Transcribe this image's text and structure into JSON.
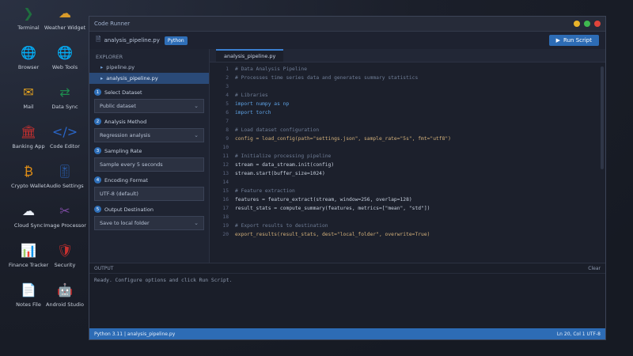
{
  "desktop": {
    "icons": [
      {
        "name": "terminal-icon",
        "glyph": "❯",
        "label": "Terminal",
        "color": "#1f6f3f"
      },
      {
        "name": "weather-icon",
        "glyph": "☁",
        "label": "Weather Widget",
        "color": "#d89a2a"
      },
      {
        "name": "browser-icon",
        "glyph": "🌐",
        "label": "Browser",
        "color": "#2a66c8"
      },
      {
        "name": "web-tools-icon",
        "glyph": "🌐",
        "label": "Web Tools",
        "color": "#2a66c8"
      },
      {
        "name": "mail-icon",
        "glyph": "✉",
        "label": "Mail",
        "color": "#e2a11f"
      },
      {
        "name": "sync-icon",
        "glyph": "⇄",
        "label": "Data Sync",
        "color": "#1e8a4e"
      },
      {
        "name": "bank-icon",
        "glyph": "🏛",
        "label": "Banking App",
        "color": "#c8302f"
      },
      {
        "name": "code-icon",
        "glyph": "</>",
        "label": "Code Editor",
        "color": "#2a66c8"
      },
      {
        "name": "crypto-wallet-icon",
        "glyph": "₿",
        "label": "Crypto Wallet",
        "color": "#e08e16"
      },
      {
        "name": "audio-icon",
        "glyph": "🎚",
        "label": "Audio Settings",
        "color": "#2a5fb0"
      },
      {
        "name": "cloud-icon",
        "glyph": "☁",
        "label": "Cloud Sync",
        "color": "#e9eef6"
      },
      {
        "name": "image-icon",
        "glyph": "✂",
        "label": "Image Processor",
        "color": "#7b4aa0"
      },
      {
        "name": "finance-icon",
        "glyph": "📊",
        "label": "Finance Tracker",
        "color": "#c8302f"
      },
      {
        "name": "shield-icon",
        "glyph": "🛡",
        "label": "Security",
        "color": "#c8302f"
      },
      {
        "name": "document-icon",
        "glyph": "📄",
        "label": "Notes File",
        "color": "#e9eef6"
      },
      {
        "name": "android-icon",
        "glyph": "🤖",
        "label": "Android Studio",
        "color": "#3ddc84"
      }
    ]
  },
  "window": {
    "title": "Code Runner",
    "toolbar": {
      "file": "analysis_pipeline.py",
      "badge": "Python",
      "run_label": "Run Script"
    },
    "sidebar": {
      "header": "EXPLORER",
      "items": [
        {
          "label": "pipeline.py"
        },
        {
          "label": "analysis_pipeline.py"
        }
      ],
      "sections": [
        {
          "n": "1",
          "label": "Select Dataset",
          "value": "Public dataset"
        },
        {
          "n": "2",
          "label": "Analysis Method",
          "value": "Regression analysis"
        },
        {
          "n": "3",
          "label": "Sampling Rate",
          "value": "Sample every 5 seconds"
        },
        {
          "n": "4",
          "label": "Encoding Format",
          "value": "UTF-8 (default)"
        },
        {
          "n": "5",
          "label": "Output Destination",
          "value": "Save to local folder"
        }
      ]
    },
    "editor": {
      "tab": "analysis_pipeline.py",
      "lines": [
        {
          "n": "1",
          "text": "# Data Analysis Pipeline",
          "cls": "cm"
        },
        {
          "n": "2",
          "text": "# Processes time series data and generates summary statistics",
          "cls": "cm"
        },
        {
          "n": "3",
          "text": "",
          "cls": "tx"
        },
        {
          "n": "4",
          "text": "# Libraries",
          "cls": "cm"
        },
        {
          "n": "5",
          "text": "import numpy as np",
          "cls": "kw"
        },
        {
          "n": "6",
          "text": "import torch",
          "cls": "kw"
        },
        {
          "n": "7",
          "text": "",
          "cls": "tx"
        },
        {
          "n": "8",
          "text": "# Load dataset configuration",
          "cls": "cm"
        },
        {
          "n": "9",
          "text": "config = load_config(path=\"settings.json\", sample_rate=\"5s\", fmt=\"utf8\")",
          "cls": "st"
        },
        {
          "n": "10",
          "text": "",
          "cls": "tx"
        },
        {
          "n": "11",
          "text": "# Initialize processing pipeline",
          "cls": "cm"
        },
        {
          "n": "12",
          "text": "stream = data_stream.init(config)",
          "cls": "tx"
        },
        {
          "n": "13",
          "text": "stream.start(buffer_size=1024)",
          "cls": "tx"
        },
        {
          "n": "14",
          "text": "",
          "cls": "tx"
        },
        {
          "n": "15",
          "text": "# Feature extraction",
          "cls": "cm"
        },
        {
          "n": "16",
          "text": "features = feature_extract(stream, window=256, overlap=128)",
          "cls": "tx"
        },
        {
          "n": "17",
          "text": "result_stats = compute_summary(features, metrics=[\"mean\", \"std\"])",
          "cls": "tx"
        },
        {
          "n": "18",
          "text": "",
          "cls": "tx"
        },
        {
          "n": "19",
          "text": "# Export results to destination",
          "cls": "cm"
        },
        {
          "n": "20",
          "text": "export_results(result_stats, dest=\"local_folder\", overwrite=True)",
          "cls": "st"
        }
      ]
    },
    "output": {
      "header": "OUTPUT",
      "clear": "Clear",
      "text": "Ready. Configure options and click Run Script."
    },
    "status": {
      "left": "Python 3.11 | analysis_pipeline.py",
      "right": "Ln 20, Col 1  UTF-8"
    },
    "colors": {
      "accent": "#2d6cb5",
      "close": "#e0443b",
      "min": "#e8b32a",
      "max": "#3fb950"
    }
  }
}
